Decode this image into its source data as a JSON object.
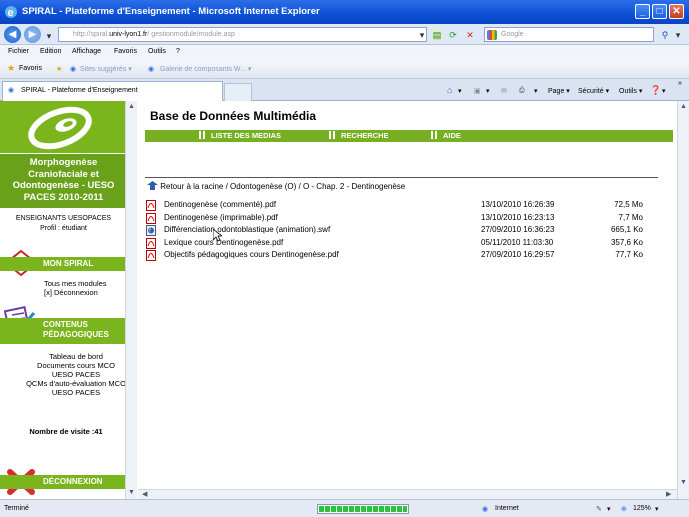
{
  "window": {
    "title": "SPIRAL - Plateforme d'Enseignement - Microsoft Internet Explorer"
  },
  "address": {
    "url_prefix": "http://spiral.",
    "url_domain": "univ-lyon1.fr",
    "url_suffix": "/ gestionmodule/module.asp",
    "search_placeholder": "Google"
  },
  "menu": [
    "Fichier",
    "Edition",
    "Affichage",
    "Favoris",
    "Outils",
    "?"
  ],
  "favorites": {
    "label": "Favoris",
    "items": [
      "Sites suggérés ▾",
      "Galerie de composants W... ▾"
    ]
  },
  "tab": {
    "label": "SPIRAL - Plateforme d'Enseignement"
  },
  "commands": [
    "Page ▾",
    "Sécurité ▾",
    "Outils ▾",
    "▾"
  ],
  "sidebar": {
    "course_title": "Morphogenèse Craniofaciale et Odontogenèse - UESO PACES 2010-2011",
    "role": "ENSEIGNANTS UESOPACES",
    "profile": "Profil : étudiant",
    "mon_spiral": {
      "heading": "MON SPIRAL",
      "items": [
        "Tous mes modules",
        "[x]  Déconnexion"
      ]
    },
    "contenus": {
      "heading_line1": "CONTENUS",
      "heading_line2": "PÉDAGOGIQUES",
      "items": [
        "Tableau de bord",
        "Documents cours MCO UESO PACES",
        "QCMs d'auto-évaluation MCO UESO PACES"
      ]
    },
    "visits_label": "Nombre de visite :41",
    "deconnexion": "DÉCONNEXION"
  },
  "main": {
    "title": "Base de Données Multimédia",
    "nav": [
      "LISTE DES MEDIAS",
      "RECHERCHE",
      "AIDE"
    ],
    "breadcrumb": "Retour à la racine / Odontogenèse (O) / O - Chap. 2 - Dentinogenèse",
    "files": [
      {
        "name": "Dentinogenèse (commenté).pdf",
        "date": "13/10/2010 16:26:39",
        "size": "72,5 Mo",
        "type": "pdf"
      },
      {
        "name": "Dentinogenèse (imprimable).pdf",
        "date": "13/10/2010 16:23:13",
        "size": "7,7 Mo",
        "type": "pdf"
      },
      {
        "name": "Différenciation odontoblastique (animation).swf",
        "date": "27/09/2010 16:36:23",
        "size": "665,1 Ko",
        "type": "swf"
      },
      {
        "name": "Lexique cours Dentinogenèse.pdf",
        "date": "05/11/2010 11:03:30",
        "size": "357,6 Ko",
        "type": "pdf"
      },
      {
        "name": "Objectifs pédagogiques cours Dentinogenèse.pdf",
        "date": "27/09/2010 16:29:57",
        "size": "77,7 Ko",
        "type": "pdf"
      }
    ]
  },
  "status": {
    "left": "Terminé",
    "zone": "Internet",
    "zoom": "125%"
  },
  "colors": {
    "spiral_green": "#7ab51d",
    "title_blue": "#0d4fd6"
  }
}
